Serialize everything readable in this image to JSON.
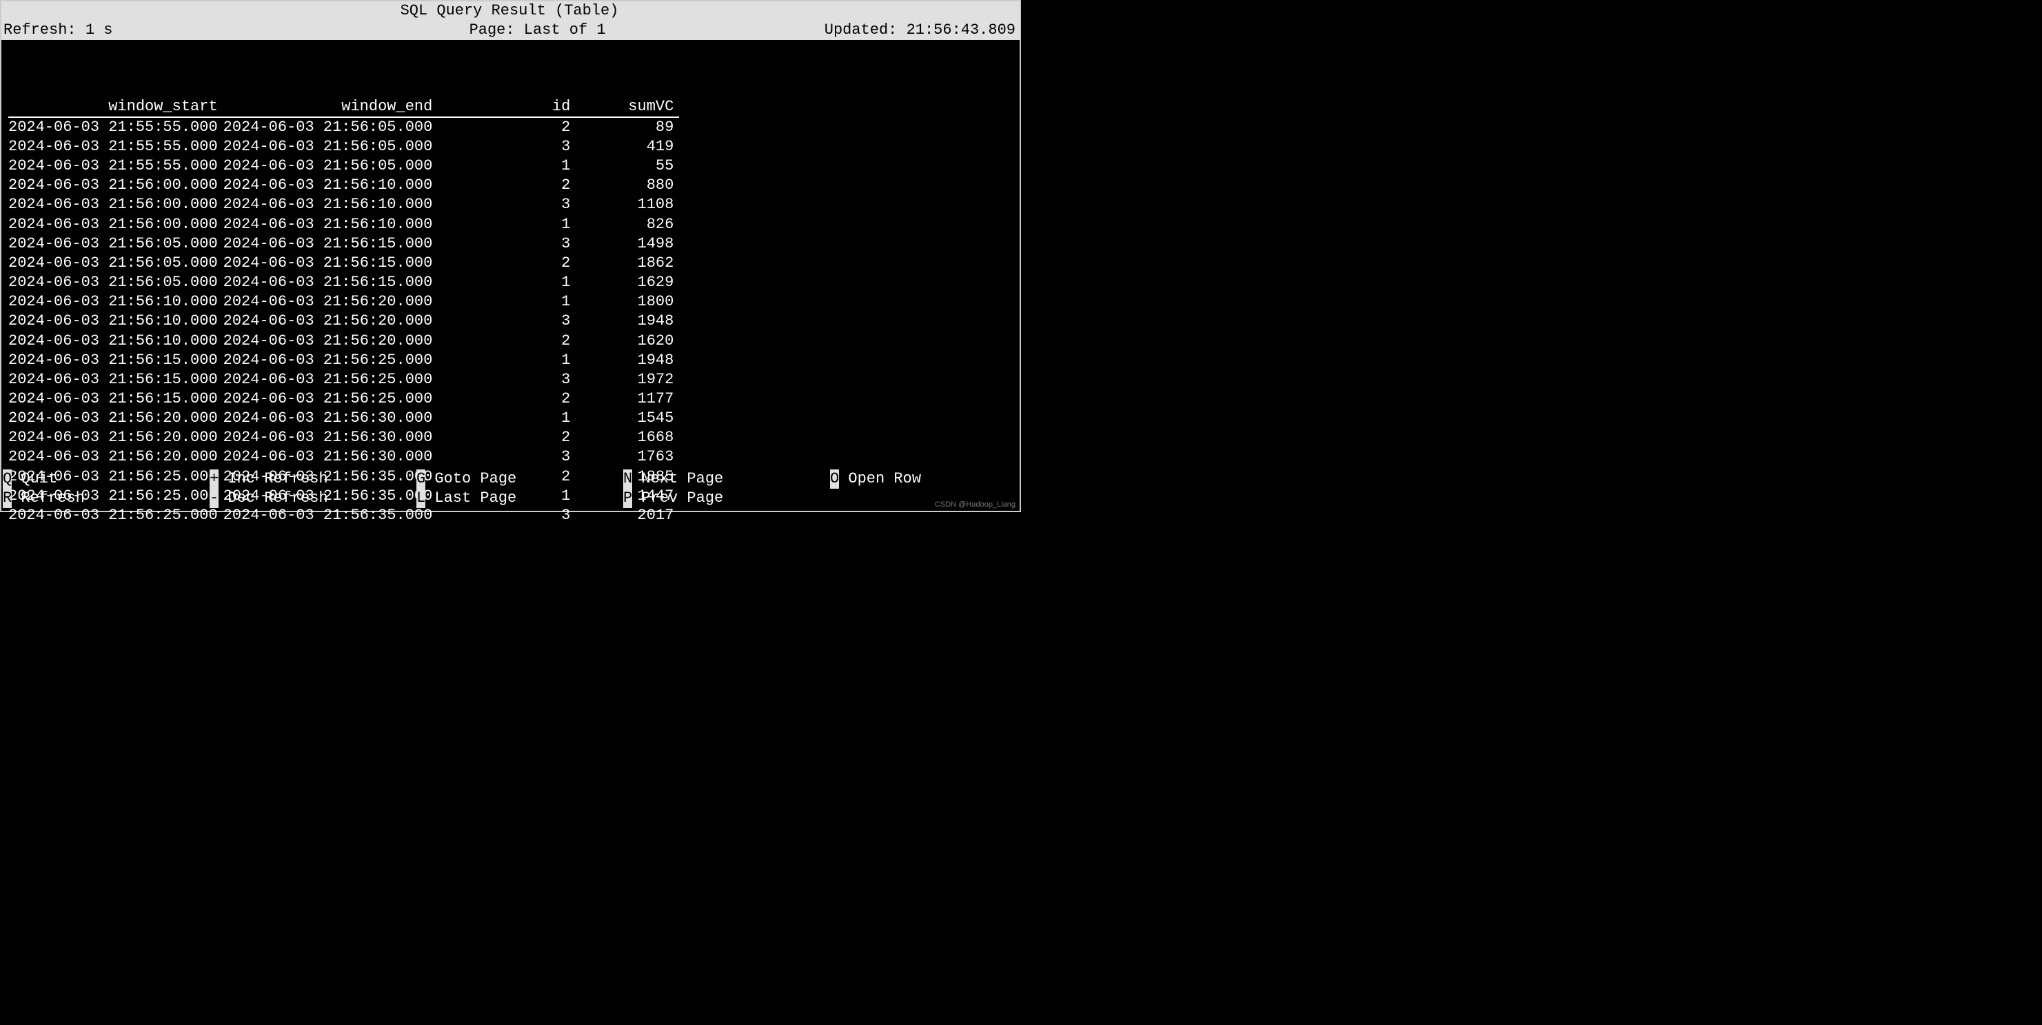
{
  "header": {
    "title": "SQL Query Result (Table)",
    "refresh_label": "Refresh: 1 s",
    "page_label": "Page: Last of 1",
    "updated_label": "Updated: 21:56:43.809"
  },
  "columns": [
    "window_start",
    "window_end",
    "id",
    "sumVC"
  ],
  "rows": [
    {
      "window_start": "2024-06-03 21:55:55.000",
      "window_end": "2024-06-03 21:56:05.000",
      "id": "2",
      "sumVC": "89"
    },
    {
      "window_start": "2024-06-03 21:55:55.000",
      "window_end": "2024-06-03 21:56:05.000",
      "id": "3",
      "sumVC": "419"
    },
    {
      "window_start": "2024-06-03 21:55:55.000",
      "window_end": "2024-06-03 21:56:05.000",
      "id": "1",
      "sumVC": "55"
    },
    {
      "window_start": "2024-06-03 21:56:00.000",
      "window_end": "2024-06-03 21:56:10.000",
      "id": "2",
      "sumVC": "880"
    },
    {
      "window_start": "2024-06-03 21:56:00.000",
      "window_end": "2024-06-03 21:56:10.000",
      "id": "3",
      "sumVC": "1108"
    },
    {
      "window_start": "2024-06-03 21:56:00.000",
      "window_end": "2024-06-03 21:56:10.000",
      "id": "1",
      "sumVC": "826"
    },
    {
      "window_start": "2024-06-03 21:56:05.000",
      "window_end": "2024-06-03 21:56:15.000",
      "id": "3",
      "sumVC": "1498"
    },
    {
      "window_start": "2024-06-03 21:56:05.000",
      "window_end": "2024-06-03 21:56:15.000",
      "id": "2",
      "sumVC": "1862"
    },
    {
      "window_start": "2024-06-03 21:56:05.000",
      "window_end": "2024-06-03 21:56:15.000",
      "id": "1",
      "sumVC": "1629"
    },
    {
      "window_start": "2024-06-03 21:56:10.000",
      "window_end": "2024-06-03 21:56:20.000",
      "id": "1",
      "sumVC": "1800"
    },
    {
      "window_start": "2024-06-03 21:56:10.000",
      "window_end": "2024-06-03 21:56:20.000",
      "id": "3",
      "sumVC": "1948"
    },
    {
      "window_start": "2024-06-03 21:56:10.000",
      "window_end": "2024-06-03 21:56:20.000",
      "id": "2",
      "sumVC": "1620"
    },
    {
      "window_start": "2024-06-03 21:56:15.000",
      "window_end": "2024-06-03 21:56:25.000",
      "id": "1",
      "sumVC": "1948"
    },
    {
      "window_start": "2024-06-03 21:56:15.000",
      "window_end": "2024-06-03 21:56:25.000",
      "id": "3",
      "sumVC": "1972"
    },
    {
      "window_start": "2024-06-03 21:56:15.000",
      "window_end": "2024-06-03 21:56:25.000",
      "id": "2",
      "sumVC": "1177"
    },
    {
      "window_start": "2024-06-03 21:56:20.000",
      "window_end": "2024-06-03 21:56:30.000",
      "id": "1",
      "sumVC": "1545"
    },
    {
      "window_start": "2024-06-03 21:56:20.000",
      "window_end": "2024-06-03 21:56:30.000",
      "id": "2",
      "sumVC": "1668"
    },
    {
      "window_start": "2024-06-03 21:56:20.000",
      "window_end": "2024-06-03 21:56:30.000",
      "id": "3",
      "sumVC": "1763"
    },
    {
      "window_start": "2024-06-03 21:56:25.000",
      "window_end": "2024-06-03 21:56:35.000",
      "id": "2",
      "sumVC": "1885"
    },
    {
      "window_start": "2024-06-03 21:56:25.000",
      "window_end": "2024-06-03 21:56:35.000",
      "id": "1",
      "sumVC": "1447"
    },
    {
      "window_start": "2024-06-03 21:56:25.000",
      "window_end": "2024-06-03 21:56:35.000",
      "id": "3",
      "sumVC": "2017"
    }
  ],
  "footer": {
    "row1": [
      {
        "key": "Q",
        "label": "Quit"
      },
      {
        "key": "+",
        "label": "Inc Refresh"
      },
      {
        "key": "G",
        "label": "Goto Page"
      },
      {
        "key": "N",
        "label": "Next Page"
      },
      {
        "key": "O",
        "label": "Open Row"
      }
    ],
    "row2": [
      {
        "key": "R",
        "label": "Refresh"
      },
      {
        "key": "-",
        "label": "Dec Refresh"
      },
      {
        "key": "L",
        "label": "Last Page"
      },
      {
        "key": "P",
        "label": "Prev Page"
      }
    ]
  },
  "watermark": "CSDN @Hadoop_Liang"
}
